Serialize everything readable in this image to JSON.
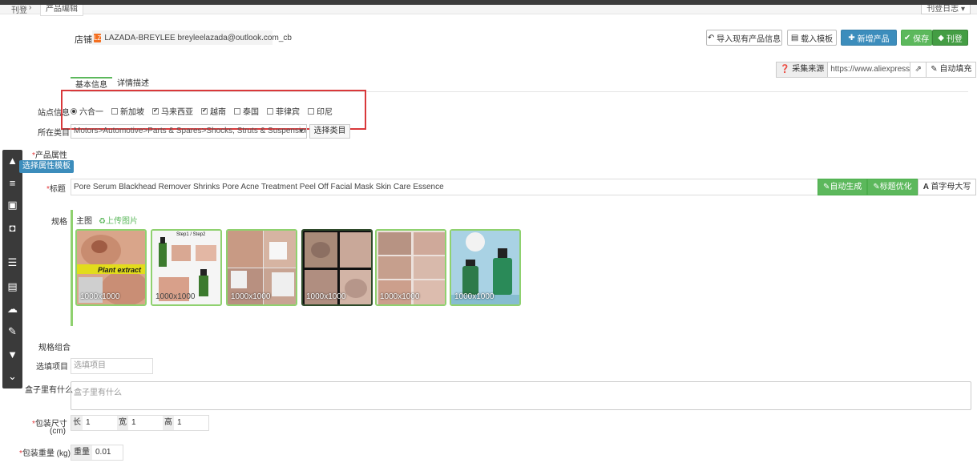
{
  "breadcrumb": {
    "home": "刊登",
    "separator": "›",
    "tab": "产品编辑"
  },
  "top_right_button": "刊登日志 ▾",
  "side_toolbar": {
    "tooltip": "选择属性模板"
  },
  "shop": {
    "label": "店铺",
    "badge": "LZ",
    "name": "LAZADA-BREYLEE breyleelazada@outlook.com_cb"
  },
  "toolbar": {
    "import_label": "导入现有产品信息",
    "template_label": "载入模板",
    "add_product_label": "新增产品",
    "save_label": "保存",
    "publish_label": "刊登"
  },
  "source": {
    "label": "采集来源",
    "url": "https://www.aliexpress.com",
    "auto_fill_label": "自动填充"
  },
  "tabs": [
    {
      "label": "基本信息"
    },
    {
      "label": "详情描述"
    }
  ],
  "sites": {
    "label": "站点信息",
    "options": [
      {
        "label": "六合一",
        "type": "radio",
        "checked": true
      },
      {
        "label": "新加坡",
        "type": "checkbox",
        "checked": false
      },
      {
        "label": "马来西亚",
        "type": "checkbox",
        "checked": true
      },
      {
        "label": "越南",
        "type": "checkbox",
        "checked": true
      },
      {
        "label": "泰国",
        "type": "checkbox",
        "checked": false
      },
      {
        "label": "菲律宾",
        "type": "checkbox",
        "checked": false
      },
      {
        "label": "印尼",
        "type": "checkbox",
        "checked": false
      }
    ]
  },
  "category": {
    "label": "所在类目",
    "value": "Motors>Automotive>Parts & Spares>Shocks, Struts & Suspension>Strut",
    "select_button": "选择类目"
  },
  "attributes": {
    "label": "产品属性"
  },
  "title": {
    "label": "标题",
    "value": "Pore Serum Blackhead Remover Shrinks Pore Acne Treatment Peel Off Facial Mask Skin Care Essence",
    "auto_generate": "自动生成",
    "optimize": "标题优化",
    "capitalize": "首字母大写"
  },
  "specs": {
    "label": "规格",
    "main_image_label": "主图",
    "upload_label": "上传图片",
    "thumbnails": [
      {
        "size": "1000x1000",
        "caption": "Plant extract"
      },
      {
        "size": "1000x1000",
        "caption": "Step1 / Step2"
      },
      {
        "size": "1000x1000",
        "caption": ""
      },
      {
        "size": "1000x1000",
        "caption": ""
      },
      {
        "size": "1000x1000",
        "caption": ""
      },
      {
        "size": "1000x1000",
        "caption": ""
      }
    ]
  },
  "spec_combo": {
    "label": "规格组合"
  },
  "optional": {
    "label": "选填项目",
    "placeholder": "选填项目"
  },
  "box_contents": {
    "label": "盒子里有什么",
    "placeholder": "盒子里有什么"
  },
  "package_size": {
    "label": "包装尺寸",
    "unit": "(cm)",
    "length_label": "长",
    "width_label": "宽",
    "height_label": "高",
    "length": "1",
    "width": "1",
    "height": "1"
  },
  "package_weight": {
    "label": "包装重量 (kg)",
    "add_label": "重量",
    "value": "0.01"
  },
  "colors": {
    "accent_green": "#5cb85c",
    "accent_blue": "#3c8dbc",
    "highlight_red": "#d9383a"
  }
}
